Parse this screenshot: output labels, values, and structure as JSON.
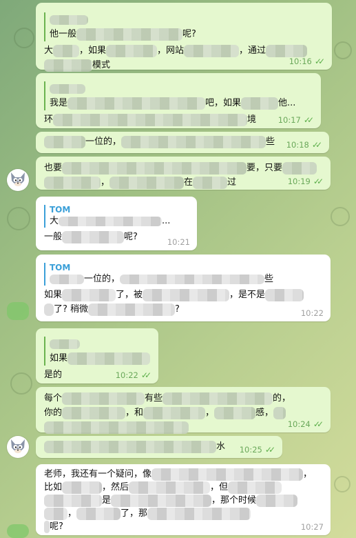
{
  "colors": {
    "out_bubble": "#e5f8cf",
    "in_bubble": "#ffffff",
    "reply_name": "#3a9fd8",
    "time_out": "#6aa85a"
  },
  "messages": [
    {
      "reply_line": "他一般",
      "reply_tail": "呢?",
      "l1a": "大",
      "l1b": "，如果",
      "l1c": "，网站",
      "l1d": "，通过",
      "l2": "模式",
      "time": "10:16"
    },
    {
      "reply_line": "我是",
      "reply_mid": "吧，如果",
      "reply_tail": "他...",
      "l1a": "环",
      "l1b": "境",
      "time": "10:17"
    },
    {
      "l1a": "一位的，",
      "l1b": "些",
      "time": "10:18"
    },
    {
      "l1a": "也要",
      "l1b": "要，只要",
      "l2a": "，",
      "l2b": "在",
      "l2c": "过",
      "time": "10:19"
    },
    {
      "reply_name": "TOM",
      "reply_line": "大",
      "reply_tail": "...",
      "l1a": "一般",
      "l1b": "呢?",
      "time": "10:21"
    },
    {
      "reply_name": "TOM",
      "reply_line": "一位的，",
      "reply_tail": "些",
      "l1a": "如果",
      "l1b": "了，被",
      "l1c": "，是不是",
      "l2a": "了? 稍微",
      "l2b": "?",
      "time": "10:22"
    },
    {
      "reply_line": "如果",
      "l1a": "是的",
      "time": "10:22"
    },
    {
      "l1a": "每个",
      "l1b": "有些",
      "l1c": "的，",
      "l2a": "你的",
      "l2b": "，和",
      "l2c": "，",
      "l2d": "感，",
      "time": "10:24"
    },
    {
      "l1a": "水",
      "time": "10:25"
    },
    {
      "l1a": "老师，我还有一个疑问，像",
      "l1b": "，",
      "l2a": "比如",
      "l2b": "，然后",
      "l2c": "，但",
      "l3a": "是",
      "l3b": "，那个时候",
      "l4a": "，",
      "l4b": "了，那",
      "l5a": "呢?",
      "time": "10:27"
    }
  ]
}
